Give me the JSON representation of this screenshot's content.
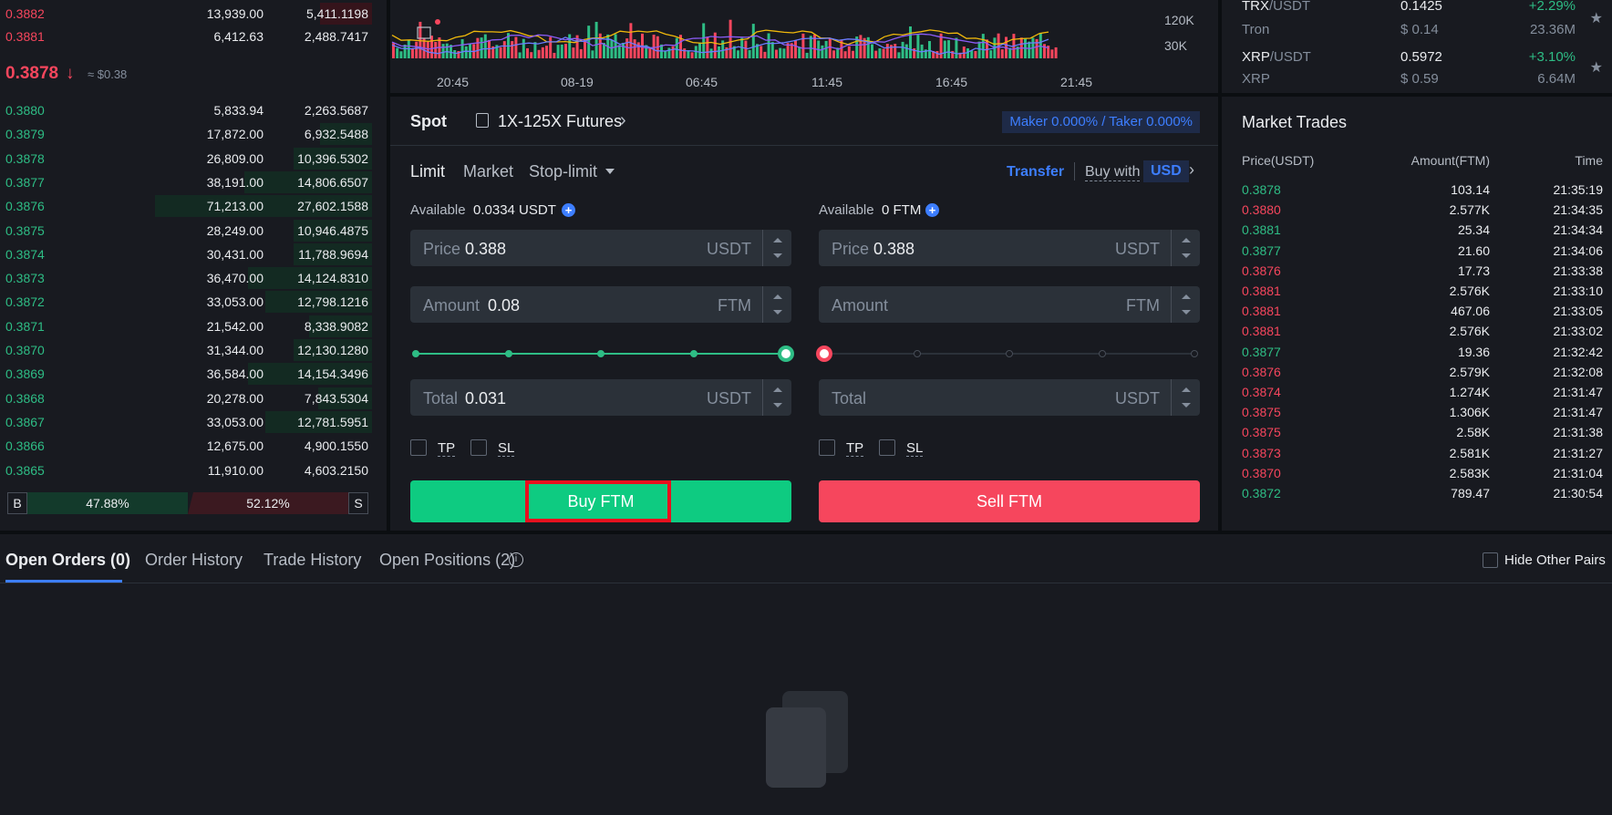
{
  "orderbook": {
    "asks": [
      {
        "price": "0.3882",
        "amount": "13,939.00",
        "total": "5,411.1198",
        "depth": 0.24
      },
      {
        "price": "0.3881",
        "amount": "6,412.63",
        "total": "2,488.7417",
        "depth": 0.0
      }
    ],
    "last_price": "0.3878",
    "last_arrow": "↓",
    "last_fiat": "≈ $0.38",
    "bids": [
      {
        "price": "0.3880",
        "amount": "5,833.94",
        "total": "2,263.5687",
        "depth": 0.0
      },
      {
        "price": "0.3879",
        "amount": "17,872.00",
        "total": "6,932.5488",
        "depth": 0.24
      },
      {
        "price": "0.3878",
        "amount": "26,809.00",
        "total": "10,396.5302",
        "depth": 0.36
      },
      {
        "price": "0.3877",
        "amount": "38,191.00",
        "total": "14,806.6507",
        "depth": 0.59
      },
      {
        "price": "0.3876",
        "amount": "71,213.00",
        "total": "27,602.1588",
        "depth": 1.0
      },
      {
        "price": "0.3875",
        "amount": "28,249.00",
        "total": "10,946.4875",
        "depth": 0.36
      },
      {
        "price": "0.3874",
        "amount": "30,431.00",
        "total": "11,788.9694",
        "depth": 0.36
      },
      {
        "price": "0.3873",
        "amount": "36,470.00",
        "total": "14,124.8310",
        "depth": 0.57
      },
      {
        "price": "0.3872",
        "amount": "33,053.00",
        "total": "12,798.1216",
        "depth": 0.49
      },
      {
        "price": "0.3871",
        "amount": "21,542.00",
        "total": "8,338.9082",
        "depth": 0.29
      },
      {
        "price": "0.3870",
        "amount": "31,344.00",
        "total": "12,130.1280",
        "depth": 0.36
      },
      {
        "price": "0.3869",
        "amount": "36,584.00",
        "total": "14,154.3496",
        "depth": 0.57
      },
      {
        "price": "0.3868",
        "amount": "20,278.00",
        "total": "7,843.5304",
        "depth": 0.25
      },
      {
        "price": "0.3867",
        "amount": "33,053.00",
        "total": "12,781.5951",
        "depth": 0.49
      },
      {
        "price": "0.3866",
        "amount": "12,675.00",
        "total": "4,900.1550",
        "depth": 0.0
      },
      {
        "price": "0.3865",
        "amount": "11,910.00",
        "total": "4,603.2150",
        "depth": 0.0
      }
    ],
    "buy_label": "B",
    "buy_pct": "47.88%",
    "sell_pct": "52.12%",
    "sell_label": "S"
  },
  "chart": {
    "x_ticks": [
      "20:45",
      "08-19",
      "06:45",
      "11:45",
      "16:45",
      "21:45"
    ],
    "y_ticks": [
      "120K",
      "30K"
    ],
    "colors": {
      "bar_up": "#2ebd85",
      "bar_down": "#f6465d",
      "ma5": "#f0b90b",
      "ma10": "#8b5cf6",
      "ma20": "#6b7cff"
    }
  },
  "trade": {
    "tab_spot": "Spot",
    "futures_label": "1X-125X Futures",
    "futures_chev": "›",
    "fees": "Maker 0.000% / Taker 0.000%",
    "order_types": {
      "limit": "Limit",
      "market": "Market",
      "stop": "Stop-limit"
    },
    "transfer": "Transfer",
    "buy_with": "Buy with",
    "usd": "USD",
    "usd_chev": "›",
    "buy": {
      "available_label": "Available",
      "available_value": "0.0334 USDT",
      "price_label": "Price",
      "price_value": "0.388",
      "price_unit": "USDT",
      "amount_label": "Amount",
      "amount_value": "0.08",
      "amount_unit": "FTM",
      "slider_pct": 100,
      "total_label": "Total",
      "total_value": "0.031",
      "total_unit": "USDT",
      "tp": "TP",
      "sl": "SL",
      "button": "Buy FTM"
    },
    "sell": {
      "available_label": "Available",
      "available_value": "0 FTM",
      "price_label": "Price",
      "price_value": "0.388",
      "price_unit": "USDT",
      "amount_label": "Amount",
      "amount_value": "",
      "amount_unit": "FTM",
      "slider_pct": 0,
      "total_label": "Total",
      "total_value": "",
      "total_unit": "USDT",
      "tp": "TP",
      "sl": "SL",
      "button": "Sell FTM"
    }
  },
  "market": {
    "pairs": [
      {
        "base": "TRX",
        "quote": "/USDT",
        "name": "Tron",
        "price": "0.1425",
        "fiat": "$ 0.14",
        "change": "+2.29%",
        "volume": "23.36M"
      },
      {
        "base": "XRP",
        "quote": "/USDT",
        "name": "XRP",
        "price": "0.5972",
        "fiat": "$ 0.59",
        "change": "+3.10%",
        "volume": "6.64M"
      }
    ]
  },
  "trades": {
    "title": "Market Trades",
    "headers": {
      "price": "Price(USDT)",
      "amount": "Amount(FTM)",
      "time": "Time"
    },
    "rows": [
      {
        "price": "0.3878",
        "side": "buy",
        "amount": "103.14",
        "time": "21:35:19"
      },
      {
        "price": "0.3880",
        "side": "sell",
        "amount": "2.577K",
        "time": "21:34:35"
      },
      {
        "price": "0.3881",
        "side": "buy",
        "amount": "25.34",
        "time": "21:34:34"
      },
      {
        "price": "0.3877",
        "side": "buy",
        "amount": "21.60",
        "time": "21:34:06"
      },
      {
        "price": "0.3876",
        "side": "sell",
        "amount": "17.73",
        "time": "21:33:38"
      },
      {
        "price": "0.3881",
        "side": "sell",
        "amount": "2.576K",
        "time": "21:33:10"
      },
      {
        "price": "0.3881",
        "side": "sell",
        "amount": "467.06",
        "time": "21:33:05"
      },
      {
        "price": "0.3881",
        "side": "sell",
        "amount": "2.576K",
        "time": "21:33:02"
      },
      {
        "price": "0.3877",
        "side": "buy",
        "amount": "19.36",
        "time": "21:32:42"
      },
      {
        "price": "0.3876",
        "side": "sell",
        "amount": "2.579K",
        "time": "21:32:08"
      },
      {
        "price": "0.3874",
        "side": "sell",
        "amount": "1.274K",
        "time": "21:31:47"
      },
      {
        "price": "0.3875",
        "side": "sell",
        "amount": "1.306K",
        "time": "21:31:47"
      },
      {
        "price": "0.3875",
        "side": "sell",
        "amount": "2.58K",
        "time": "21:31:38"
      },
      {
        "price": "0.3873",
        "side": "sell",
        "amount": "2.581K",
        "time": "21:31:27"
      },
      {
        "price": "0.3870",
        "side": "sell",
        "amount": "2.583K",
        "time": "21:31:04"
      },
      {
        "price": "0.3872",
        "side": "buy",
        "amount": "789.47",
        "time": "21:30:54"
      }
    ]
  },
  "bottom": {
    "tabs": [
      "Open Orders (0)",
      "Order History",
      "Trade History",
      "Open Positions (2)"
    ],
    "info_glyph": "i",
    "hide_other_pairs": "Hide Other Pairs"
  }
}
